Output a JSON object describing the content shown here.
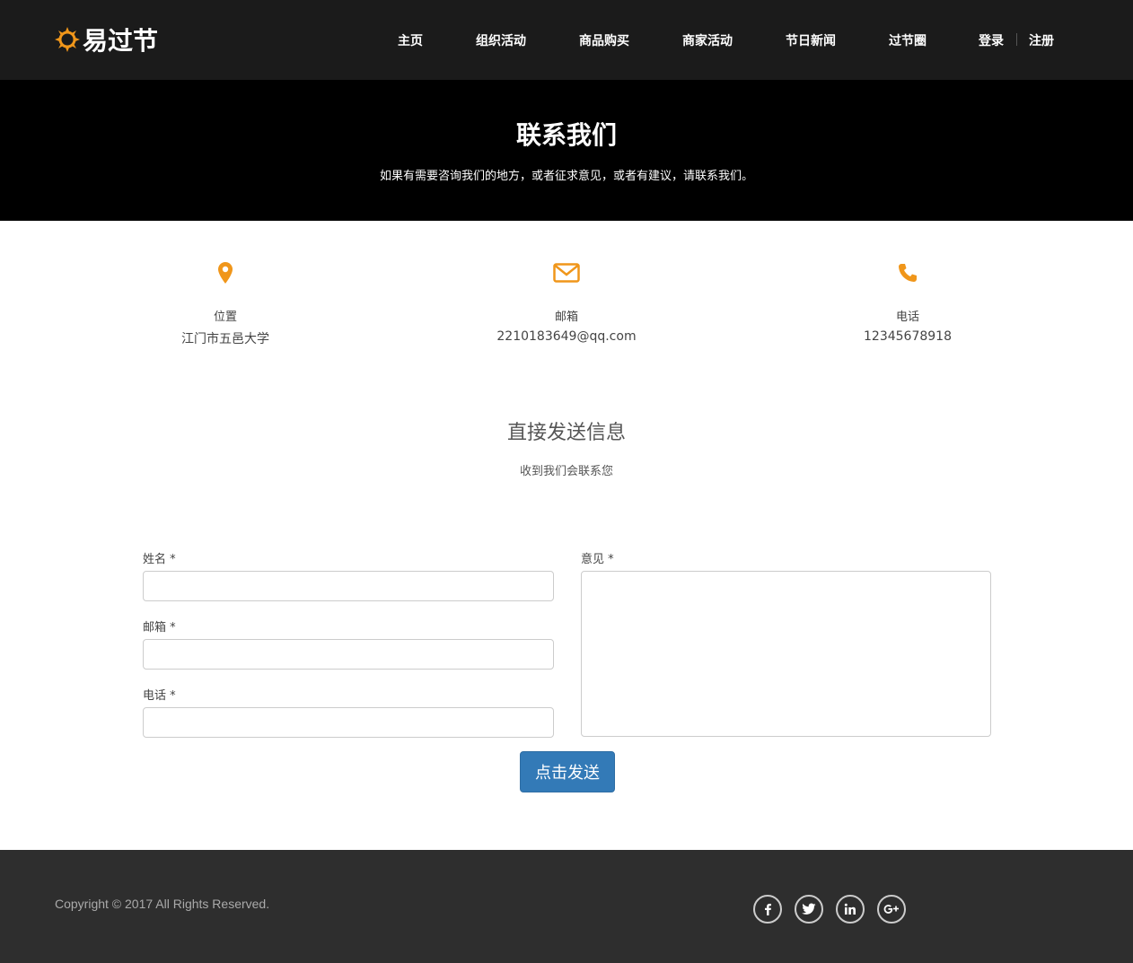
{
  "brand": {
    "name": "易过节",
    "accent": "#f0961a"
  },
  "nav": {
    "items": [
      "主页",
      "组织活动",
      "商品购买",
      "商家活动",
      "节日新闻",
      "过节圈"
    ],
    "login": "登录",
    "register": "注册"
  },
  "hero": {
    "title": "联系我们",
    "subtitle": "如果有需要咨询我们的地方，或者征求意见，或者有建议，请联系我们。"
  },
  "contact": [
    {
      "icon": "location-pin-icon",
      "label": "位置",
      "value": "江门市五邑大学"
    },
    {
      "icon": "envelope-icon",
      "label": "邮箱",
      "value": "2210183649@qq.com"
    },
    {
      "icon": "phone-icon",
      "label": "电话",
      "value": "12345678918"
    }
  ],
  "form": {
    "title": "直接发送信息",
    "subtitle": "收到我们会联系您",
    "name_label": "姓名 *",
    "email_label": "邮箱 *",
    "phone_label": "电话 *",
    "message_label": "意见 *",
    "submit": "点击发送"
  },
  "footer": {
    "copyright": "Copyright © 2017 All Rights Reserved.",
    "social": [
      "facebook-icon",
      "twitter-icon",
      "linkedin-icon",
      "google-plus-icon"
    ]
  }
}
